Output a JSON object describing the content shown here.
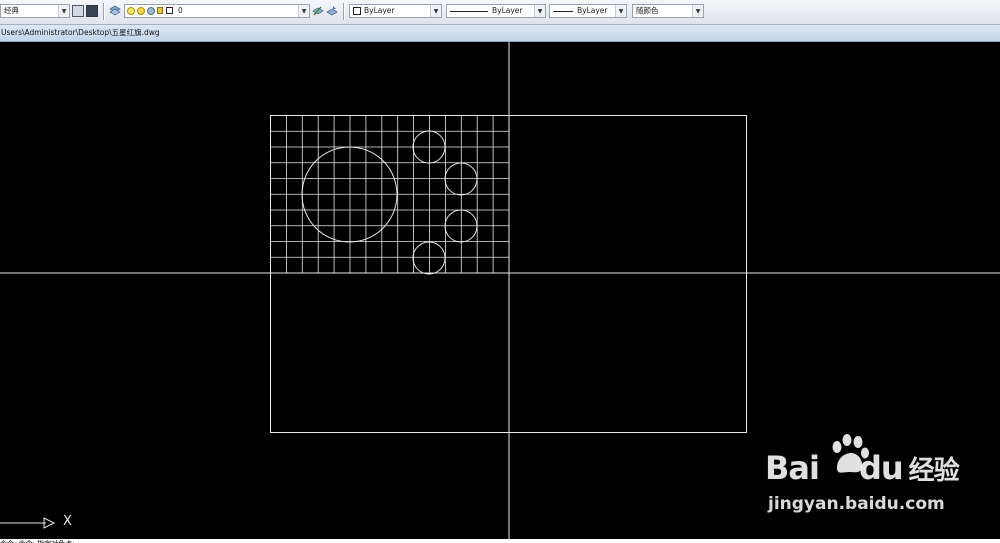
{
  "toolbar": {
    "workspace_value": "经典",
    "layer_value": "0",
    "color_value": "ByLayer",
    "linetype_value": "ByLayer",
    "lineweight_value": "ByLayer",
    "plotstyle_value": "随颜色"
  },
  "file_path": "Users\\Administrator\\Desktop\\五星红旗.dwg",
  "ucs": {
    "x_label": "X"
  },
  "command_line": {
    "text": "命令: 命令: 指定对角点:"
  },
  "watermark": {
    "brand_bai": "Bai",
    "brand_du": "du",
    "brand_jingyan": "经验",
    "url": "jingyan.baidu.com"
  },
  "colors": {
    "canvas": "#000000",
    "lines": "#e8e8e8",
    "toolbar": "#e4e8ee",
    "pathbar": "#cfdcec"
  },
  "icons": [
    "layer-states-icon",
    "bulb-on-icon",
    "sun-icon",
    "lock-icon",
    "color-square-icon",
    "match-layer-icon",
    "layer-prev-icon",
    "ucs-arrow-icon",
    "paw-logo-icon"
  ]
}
